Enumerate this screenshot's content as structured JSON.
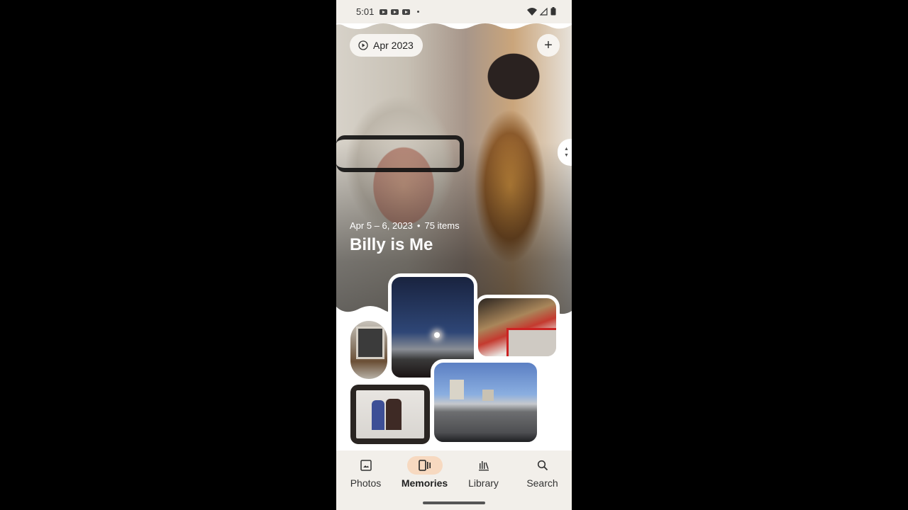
{
  "status_bar": {
    "time": "5:01",
    "notification_icons": [
      "youtube-icon",
      "youtube-icon",
      "youtube-icon"
    ],
    "system_icons": [
      "wifi-icon",
      "signal-icon",
      "battery-icon"
    ]
  },
  "memory": {
    "date_chip_label": "Apr 2023",
    "date_range": "Apr 5 – 6, 2023",
    "separator": "•",
    "item_count": "75 items",
    "title": "Billy is Me",
    "add_button_icon": "plus-icon"
  },
  "thumbnails": [
    {
      "name": "framed-portrait-photo"
    },
    {
      "name": "night-highway-photo"
    },
    {
      "name": "red-framed-artwork-photo"
    },
    {
      "name": "framed-two-people-photo"
    },
    {
      "name": "street-grain-elevator-photo"
    }
  ],
  "bottom_nav": {
    "items": [
      {
        "label": "Photos",
        "icon": "photo-icon",
        "active": false
      },
      {
        "label": "Memories",
        "icon": "memories-icon",
        "active": true
      },
      {
        "label": "Library",
        "icon": "library-icon",
        "active": false
      },
      {
        "label": "Search",
        "icon": "search-icon",
        "active": false
      }
    ]
  },
  "colors": {
    "active_nav_pill": "#f7d9c0",
    "nav_background": "#f2efea"
  }
}
